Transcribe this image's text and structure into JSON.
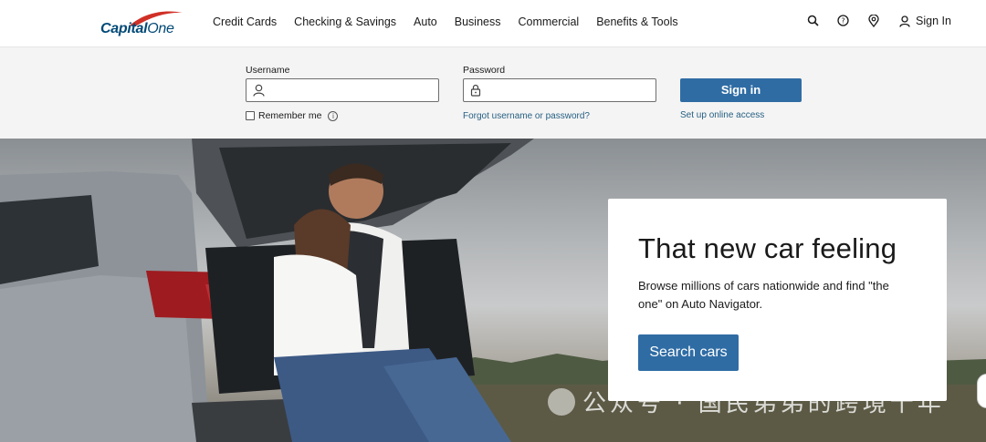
{
  "brand": {
    "name_part1": "Capital",
    "name_part2": "One",
    "color": "#004977",
    "swoosh_color": "#d03027"
  },
  "nav": {
    "items": [
      "Credit Cards",
      "Checking & Savings",
      "Auto",
      "Business",
      "Commercial",
      "Benefits & Tools"
    ]
  },
  "utility": {
    "icons": [
      "search-icon",
      "help-icon",
      "location-pin-icon",
      "user-icon"
    ],
    "signin_label": "Sign In"
  },
  "login": {
    "username_label": "Username",
    "username_value": "",
    "password_label": "Password",
    "password_value": "",
    "remember_label": "Remember me",
    "remember_checked": false,
    "forgot_link": "Forgot username or password?",
    "signin_button": "Sign in",
    "setup_link": "Set up online access",
    "button_color": "#2f6ca4"
  },
  "hero": {
    "title": "That new car feeling",
    "description": "Browse millions of cars nationwide and find \"the one\" on Auto Navigator.",
    "cta": "Search cars",
    "watermark": "公众号 · 国民弟弟的跨境十年"
  }
}
